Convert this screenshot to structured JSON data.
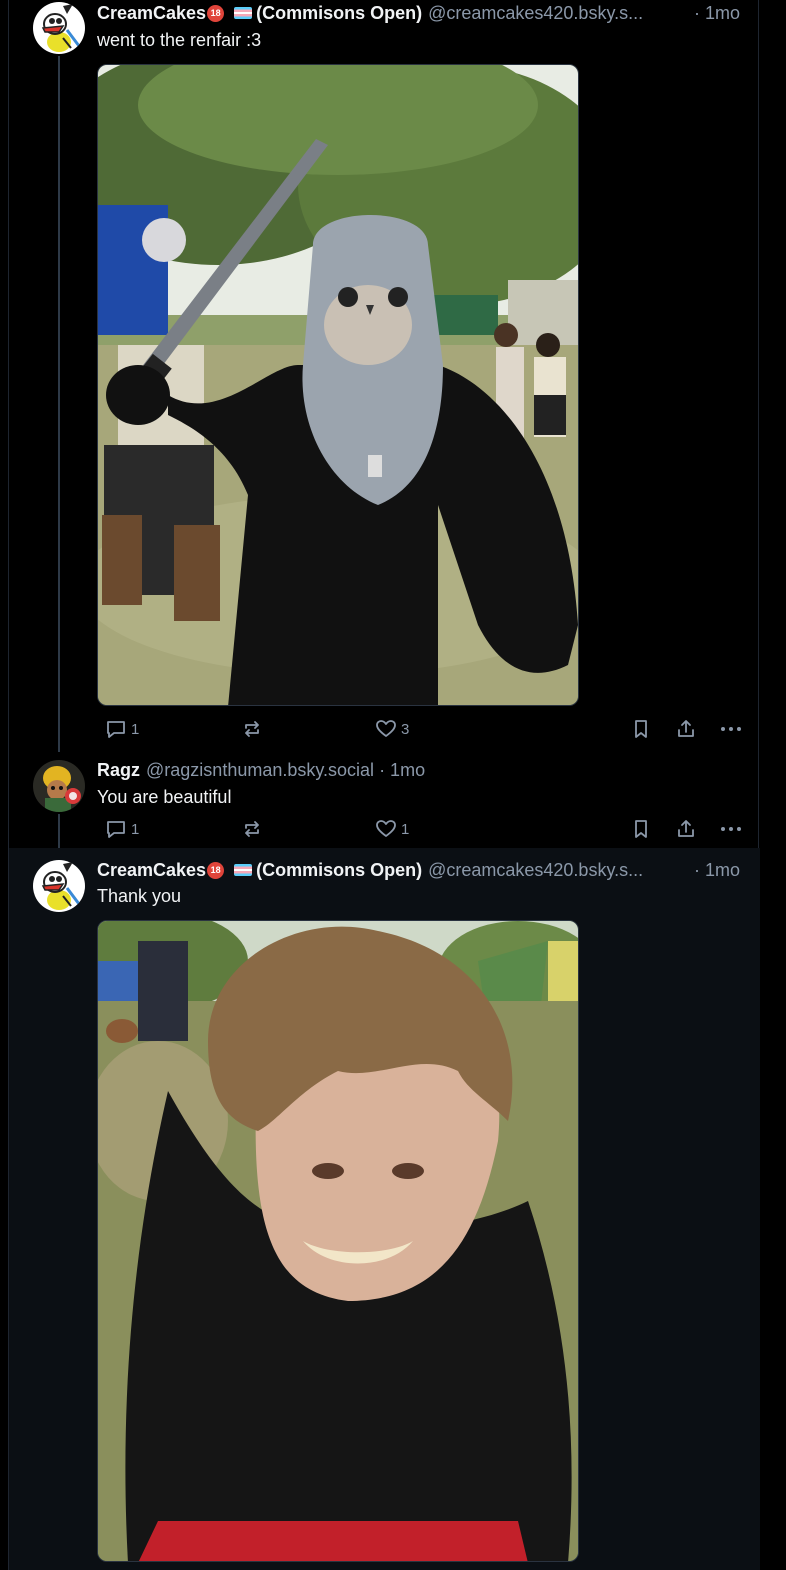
{
  "posts": [
    {
      "author": {
        "display_name": "CreamCakes",
        "badge": "18",
        "suffix": "(Commisons Open)",
        "handle": "@creamcakes420.bsky.s...",
        "avatar_icon": "cartoon-duck-avatar"
      },
      "time": "· 1mo",
      "text": "went to the renfair :3",
      "media": {
        "type": "photo",
        "alt_icon": "renfair-chainmail-photo"
      },
      "actions": {
        "reply_count": "1",
        "repost_count": "",
        "like_count": "3"
      }
    },
    {
      "author": {
        "display_name": "Ragz",
        "handle": "@ragzisnthuman.bsky.social",
        "avatar_icon": "figure-avatar"
      },
      "time": "· 1mo",
      "text": "You are beautiful",
      "actions": {
        "reply_count": "1",
        "repost_count": "",
        "like_count": "1"
      }
    },
    {
      "author": {
        "display_name": "CreamCakes",
        "badge": "18",
        "suffix": "(Commisons Open)",
        "handle": "@creamcakes420.bsky.s...",
        "avatar_icon": "cartoon-duck-avatar"
      },
      "time": "· 1mo",
      "text": "Thank you",
      "media": {
        "type": "photo",
        "alt_icon": "selfie-photo"
      }
    }
  ],
  "colors": {
    "background": "#000000",
    "focused_post": "#0b0f14",
    "text": "#f1f3f5",
    "muted": "#8b98a9",
    "thread_line": "#2e3a48"
  }
}
